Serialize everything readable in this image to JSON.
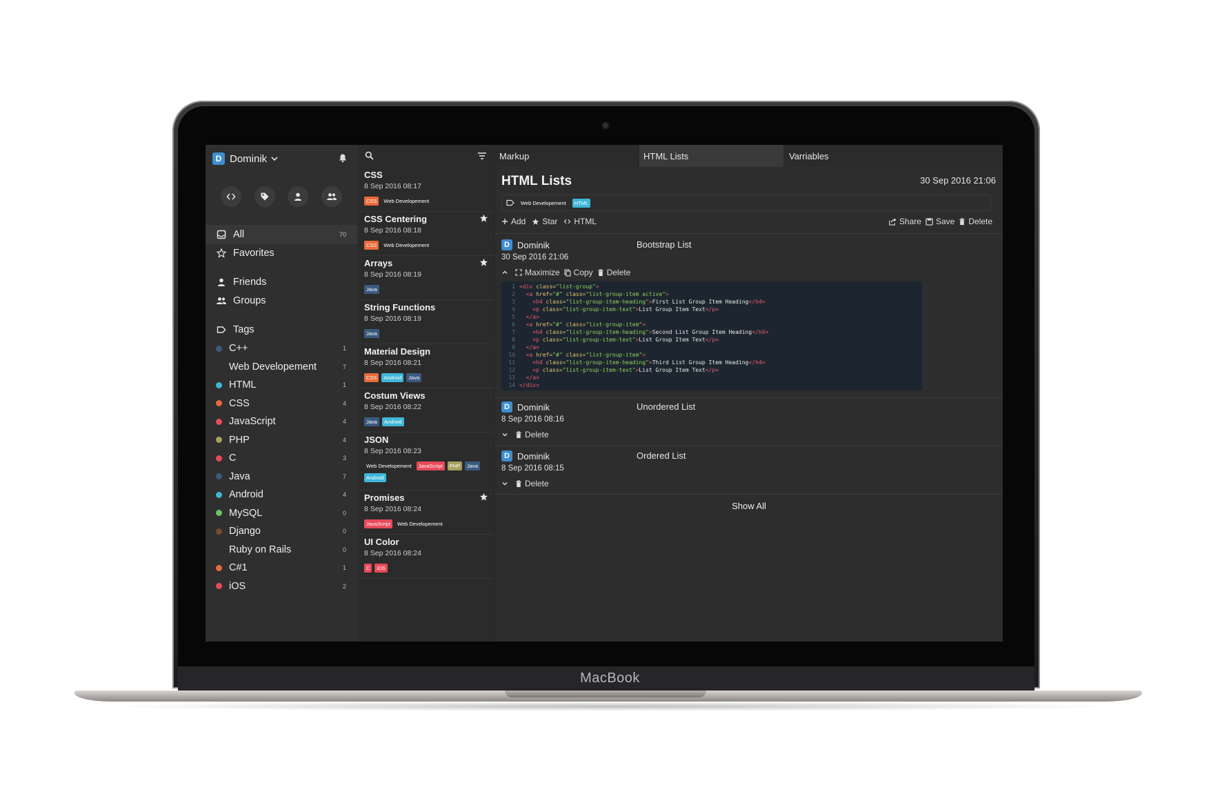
{
  "device": {
    "brand": "MacBook"
  },
  "sidebar": {
    "user": {
      "initial": "D",
      "name": "Dominik"
    },
    "nav": [
      {
        "label": "All",
        "count": "70"
      },
      {
        "label": "Favorites"
      },
      {
        "label": "Friends"
      },
      {
        "label": "Groups"
      },
      {
        "label": "Tags"
      }
    ],
    "tags": [
      {
        "label": "C++",
        "count": "1",
        "color": "#3b5a80"
      },
      {
        "label": "Web Developement",
        "count": "7",
        "color": "#2f2f2f"
      },
      {
        "label": "HTML",
        "count": "1",
        "color": "#3fb6d8"
      },
      {
        "label": "CSS",
        "count": "4",
        "color": "#e96a3a"
      },
      {
        "label": "JavaScript",
        "count": "4",
        "color": "#e84a5a"
      },
      {
        "label": "PHP",
        "count": "4",
        "color": "#a8a060"
      },
      {
        "label": "C",
        "count": "3",
        "color": "#e84a5a"
      },
      {
        "label": "Java",
        "count": "7",
        "color": "#3b5a80"
      },
      {
        "label": "Android",
        "count": "4",
        "color": "#3fb6d8"
      },
      {
        "label": "MySQL",
        "count": "0",
        "color": "#6ac46a"
      },
      {
        "label": "Django",
        "count": "0",
        "color": "#7a4a2e"
      },
      {
        "label": "Ruby on Rails",
        "count": "0",
        "color": "#2f2f2f"
      },
      {
        "label": "C#1",
        "count": "1",
        "color": "#e96a3a"
      },
      {
        "label": "iOS",
        "count": "2",
        "color": "#e84a5a"
      }
    ]
  },
  "notes": [
    {
      "title": "CSS",
      "date": "8 Sep 2016 08:17",
      "starred": false,
      "badges": [
        {
          "label": "CSS",
          "color": "#e96a3a"
        },
        {
          "label": "Web Developement",
          "color": "transparent"
        }
      ]
    },
    {
      "title": "CSS Centering",
      "date": "8 Sep 2016 08:18",
      "starred": true,
      "badges": [
        {
          "label": "CSS",
          "color": "#e96a3a"
        },
        {
          "label": "Web Developement",
          "color": "transparent"
        }
      ]
    },
    {
      "title": "Arrays",
      "date": "8 Sep 2016 08:19",
      "starred": true,
      "badges": [
        {
          "label": "Java",
          "color": "#3b5a80"
        }
      ]
    },
    {
      "title": "String Functions",
      "date": "8 Sep 2016 08:19",
      "starred": false,
      "badges": [
        {
          "label": "Java",
          "color": "#3b5a80"
        }
      ]
    },
    {
      "title": "Material Design",
      "date": "8 Sep 2016 08:21",
      "starred": false,
      "badges": [
        {
          "label": "CSS",
          "color": "#e96a3a"
        },
        {
          "label": "Android",
          "color": "#3fb6d8"
        },
        {
          "label": "Java",
          "color": "#3b5a80"
        }
      ]
    },
    {
      "title": "Costum Views",
      "date": "8 Sep 2016 08:22",
      "starred": false,
      "badges": [
        {
          "label": "Java",
          "color": "#3b5a80"
        },
        {
          "label": "Android",
          "color": "#3fb6d8"
        }
      ]
    },
    {
      "title": "JSON",
      "date": "8 Sep 2016 08:23",
      "starred": false,
      "badges": [
        {
          "label": "Web Developement",
          "color": "transparent"
        },
        {
          "label": "JavaScript",
          "color": "#e84a5a"
        },
        {
          "label": "PHP",
          "color": "#a8a060"
        },
        {
          "label": "Java",
          "color": "#3b5a80"
        },
        {
          "label": "Android",
          "color": "#3fb6d8"
        }
      ]
    },
    {
      "title": "Promises",
      "date": "8 Sep 2016 08:24",
      "starred": true,
      "badges": [
        {
          "label": "JavaScript",
          "color": "#e84a5a"
        },
        {
          "label": "Web Developement",
          "color": "transparent"
        }
      ]
    },
    {
      "title": "UI Color",
      "date": "8 Sep 2016 08:24",
      "starred": false,
      "badges": [
        {
          "label": "C",
          "color": "#e84a5a"
        },
        {
          "label": "iOS",
          "color": "#e84a5a"
        }
      ]
    }
  ],
  "tabs": [
    {
      "label": "Markup"
    },
    {
      "label": "HTML Lists"
    },
    {
      "label": "Varriables"
    }
  ],
  "doc": {
    "title": "HTML Lists",
    "date": "30 Sep 2016 21:06",
    "tags": [
      {
        "label": "Web Developement",
        "color": "transparent"
      },
      {
        "label": "HTML",
        "color": "#3fb6d8"
      }
    ],
    "toolbar": {
      "add": "Add",
      "star": "Star",
      "html": "HTML",
      "share": "Share",
      "save": "Save",
      "delete": "Delete"
    }
  },
  "snippets": [
    {
      "user": "Dominik",
      "initial": "D",
      "title": "Bootstrap List",
      "date": "30 Sep 2016 21:06",
      "actions": {
        "maximize": "Maximize",
        "copy": "Copy",
        "delete": "Delete"
      }
    },
    {
      "user": "Dominik",
      "initial": "D",
      "title": "Unordered List",
      "date": "8 Sep 2016 08:16",
      "actions": {
        "delete": "Delete"
      }
    },
    {
      "user": "Dominik",
      "initial": "D",
      "title": "Ordered List",
      "date": "8 Sep 2016 08:15",
      "actions": {
        "delete": "Delete"
      }
    }
  ],
  "code": [
    {
      "n": "1",
      "indent": "",
      "parts": [
        [
          "tag",
          "<div "
        ],
        [
          "attr",
          "class="
        ],
        [
          "str",
          "\"list-group\""
        ],
        [
          "tag",
          ">"
        ]
      ]
    },
    {
      "n": "2",
      "indent": "  ",
      "parts": [
        [
          "tag",
          "<a "
        ],
        [
          "attr",
          "href="
        ],
        [
          "str",
          "\"#\" "
        ],
        [
          "attr",
          "class="
        ],
        [
          "str",
          "\"list-group-item active\""
        ],
        [
          "tag",
          ">"
        ]
      ]
    },
    {
      "n": "3",
      "indent": "    ",
      "parts": [
        [
          "tag",
          "<h4 "
        ],
        [
          "attr",
          "class="
        ],
        [
          "str",
          "\"list-group-item-heading\""
        ],
        [
          "tag",
          ">"
        ],
        [
          "txt",
          "First List Group Item Heading"
        ],
        [
          "tag",
          "</h4>"
        ]
      ]
    },
    {
      "n": "4",
      "indent": "    ",
      "parts": [
        [
          "tag",
          "<p "
        ],
        [
          "attr",
          "class="
        ],
        [
          "str",
          "\"list-group-item-text\""
        ],
        [
          "tag",
          ">"
        ],
        [
          "txt",
          "List Group Item Text"
        ],
        [
          "tag",
          "</p>"
        ]
      ]
    },
    {
      "n": "5",
      "indent": "  ",
      "parts": [
        [
          "tag",
          "</a>"
        ]
      ]
    },
    {
      "n": "6",
      "indent": "  ",
      "parts": [
        [
          "tag",
          "<a "
        ],
        [
          "attr",
          "href="
        ],
        [
          "str",
          "\"#\" "
        ],
        [
          "attr",
          "class="
        ],
        [
          "str",
          "\"list-group-item\""
        ],
        [
          "tag",
          ">"
        ]
      ]
    },
    {
      "n": "7",
      "indent": "    ",
      "parts": [
        [
          "tag",
          "<h4 "
        ],
        [
          "attr",
          "class="
        ],
        [
          "str",
          "\"list-group-item-heading\""
        ],
        [
          "tag",
          ">"
        ],
        [
          "txt",
          "Second List Group Item Heading"
        ],
        [
          "tag",
          "</h4>"
        ]
      ]
    },
    {
      "n": "8",
      "indent": "    ",
      "parts": [
        [
          "tag",
          "<p "
        ],
        [
          "attr",
          "class="
        ],
        [
          "str",
          "\"list-group-item-text\""
        ],
        [
          "tag",
          ">"
        ],
        [
          "txt",
          "List Group Item Text"
        ],
        [
          "tag",
          "</p>"
        ]
      ]
    },
    {
      "n": "9",
      "indent": "  ",
      "parts": [
        [
          "tag",
          "</a>"
        ]
      ]
    },
    {
      "n": "10",
      "indent": "  ",
      "parts": [
        [
          "tag",
          "<a "
        ],
        [
          "attr",
          "href="
        ],
        [
          "str",
          "\"#\" "
        ],
        [
          "attr",
          "class="
        ],
        [
          "str",
          "\"list-group-item\""
        ],
        [
          "tag",
          ">"
        ]
      ]
    },
    {
      "n": "11",
      "indent": "    ",
      "parts": [
        [
          "tag",
          "<h4 "
        ],
        [
          "attr",
          "class="
        ],
        [
          "str",
          "\"list-group-item-heading\""
        ],
        [
          "tag",
          ">"
        ],
        [
          "txt",
          "Third List Group Item Heading"
        ],
        [
          "tag",
          "</h4>"
        ]
      ]
    },
    {
      "n": "12",
      "indent": "    ",
      "parts": [
        [
          "tag",
          "<p "
        ],
        [
          "attr",
          "class="
        ],
        [
          "str",
          "\"list-group-item-text\""
        ],
        [
          "tag",
          ">"
        ],
        [
          "txt",
          "List Group Item Text"
        ],
        [
          "tag",
          "</p>"
        ]
      ]
    },
    {
      "n": "13",
      "indent": "  ",
      "parts": [
        [
          "tag",
          "</a>"
        ]
      ]
    },
    {
      "n": "14",
      "indent": "",
      "parts": [
        [
          "tag",
          "</div>"
        ]
      ]
    }
  ],
  "show_all": "Show All"
}
